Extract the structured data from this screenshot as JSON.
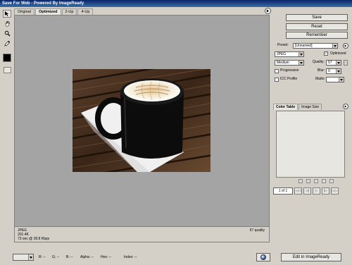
{
  "window": {
    "title": "Save For Web - Powered By ImageReady"
  },
  "tabs": [
    "Original",
    "Optimized",
    "2-Up",
    "4-Up"
  ],
  "active_tab": "Optimized",
  "toolbox": {
    "tools": [
      "slice-select-icon",
      "hand-icon",
      "zoom-icon",
      "eyedropper-icon"
    ],
    "swatch_color": "#000000"
  },
  "image_info": {
    "format": "JPEG",
    "size": "201.4K",
    "time": "73 sec @ 28.8 Kbps",
    "quality": "57 quality"
  },
  "panel": {
    "save_label": "Save",
    "reset_label": "Reset",
    "remember_label": "Remember",
    "preset_label": "Preset:",
    "preset_value": "[Unnamed]",
    "format_value": "JPEG",
    "optimized_label": "Optimized",
    "optimized_checked": true,
    "quality_level_value": "Medium",
    "quality_label": "Quality:",
    "quality_value": "57",
    "progressive_label": "Progressive",
    "blur_label": "Blur:",
    "blur_value": "0",
    "icc_label": "ICC Profile",
    "matte_label": "Matte:",
    "color_table_tab": "Color Table",
    "image_size_tab": "Image Size",
    "page_indicator": "1 of 1"
  },
  "statusbar": {
    "r_label": "R:",
    "r_value": "--",
    "g_label": "G:",
    "g_value": "--",
    "b_label": "B:",
    "b_value": "--",
    "alpha_label": "Alpha:",
    "alpha_value": "--",
    "hex_label": "Hex:",
    "hex_value": "--",
    "index_label": "Index:",
    "index_value": "--",
    "edit_button": "Edit in ImageReady"
  }
}
